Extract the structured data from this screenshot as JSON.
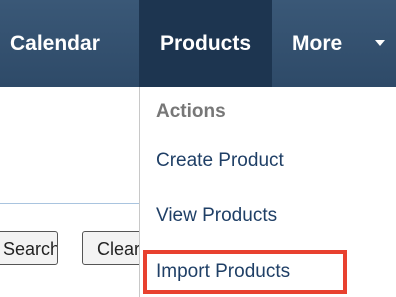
{
  "nav": {
    "calendar": "Calendar",
    "products": "Products",
    "more": "More"
  },
  "buttons": {
    "search": "Search",
    "clear": "Clear"
  },
  "menu": {
    "header": "Actions",
    "items": [
      "Create Product",
      "View Products",
      "Import Products"
    ]
  },
  "colors": {
    "nav_bg": "#2e4a68",
    "nav_active": "#1d3550",
    "menu_link": "#1f3f66",
    "highlight": "#e8412f"
  }
}
